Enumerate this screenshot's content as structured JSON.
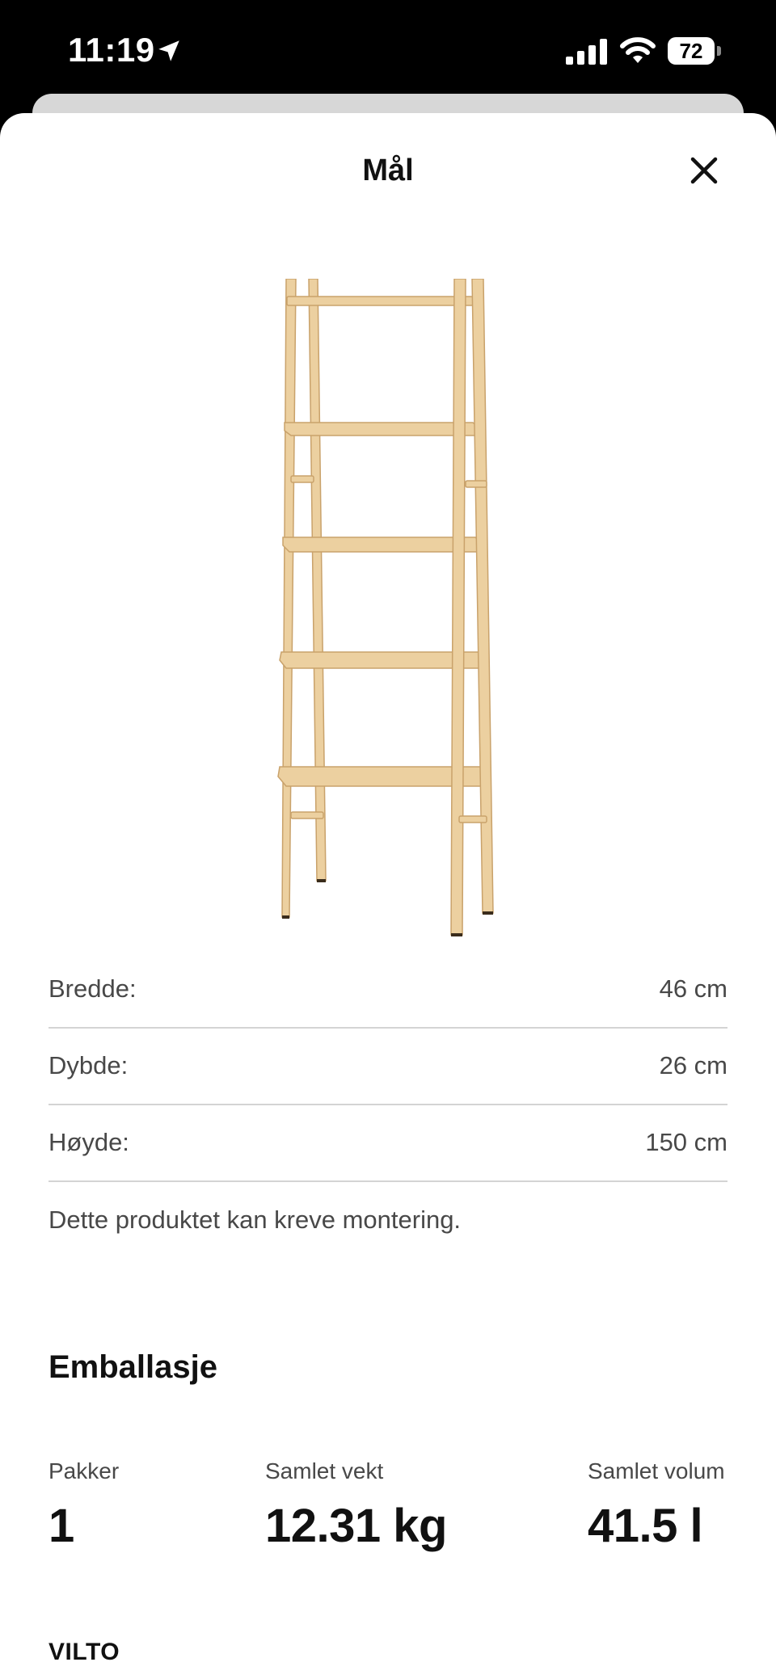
{
  "status_bar": {
    "time": "11:19",
    "battery": "72",
    "icons": [
      "location-arrow-icon",
      "cellular-signal-icon",
      "wifi-icon",
      "battery-icon"
    ]
  },
  "sheet": {
    "title": "Mål",
    "close_icon": "close-icon"
  },
  "product_image": {
    "description_icon": "ladder-shelf-image",
    "wood_color": "#e9c994"
  },
  "dimensions": [
    {
      "label": "Bredde:",
      "value": "46 cm"
    },
    {
      "label": "Dybde:",
      "value": "26 cm"
    },
    {
      "label": "Høyde:",
      "value": "150 cm"
    }
  ],
  "assembly_note": "Dette produktet kan kreve montering.",
  "packaging": {
    "heading": "Emballasje",
    "packages_label": "Pakker",
    "packages_value": "1",
    "weight_label": "Samlet vekt",
    "weight_value": "12.31 kg",
    "volume_label": "Samlet volum",
    "volume_value": "41.5 l",
    "item_name": "VILTO"
  }
}
